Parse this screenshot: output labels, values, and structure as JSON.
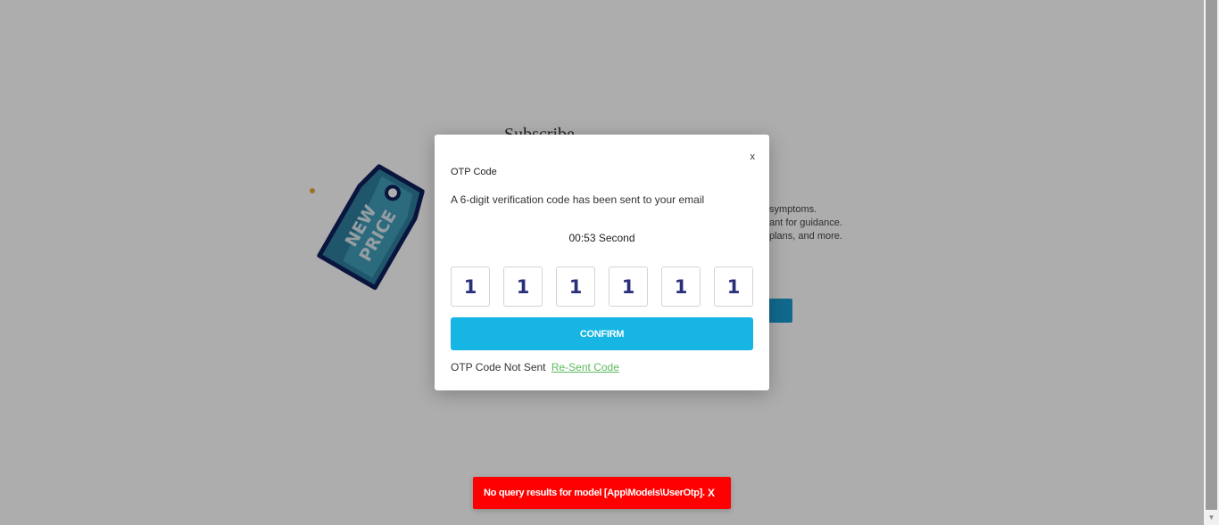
{
  "background": {
    "title": "Subscribe",
    "lines": [
      "symptoms.",
      "ant for guidance.",
      "plans, and more."
    ],
    "tag_text_line1": "NEW",
    "tag_text_line2": "PRICE"
  },
  "modal": {
    "close_label": "x",
    "title": "OTP Code",
    "description": "A 6-digit verification code has been sent to your email",
    "timer": "00:53 Second",
    "otp_digits": [
      "1",
      "1",
      "1",
      "1",
      "1",
      "1"
    ],
    "confirm_label": "CONFIRM",
    "not_sent_text": "OTP Code Not Sent",
    "resend_label": "Re-Sent Code"
  },
  "toast": {
    "message": "No query results for model [App\\Models\\UserOtp].",
    "close_label": "X"
  },
  "colors": {
    "accent": "#16b5e3",
    "toast": "#ff0000",
    "link": "#5cb85c",
    "digit": "#2a2f7a"
  }
}
